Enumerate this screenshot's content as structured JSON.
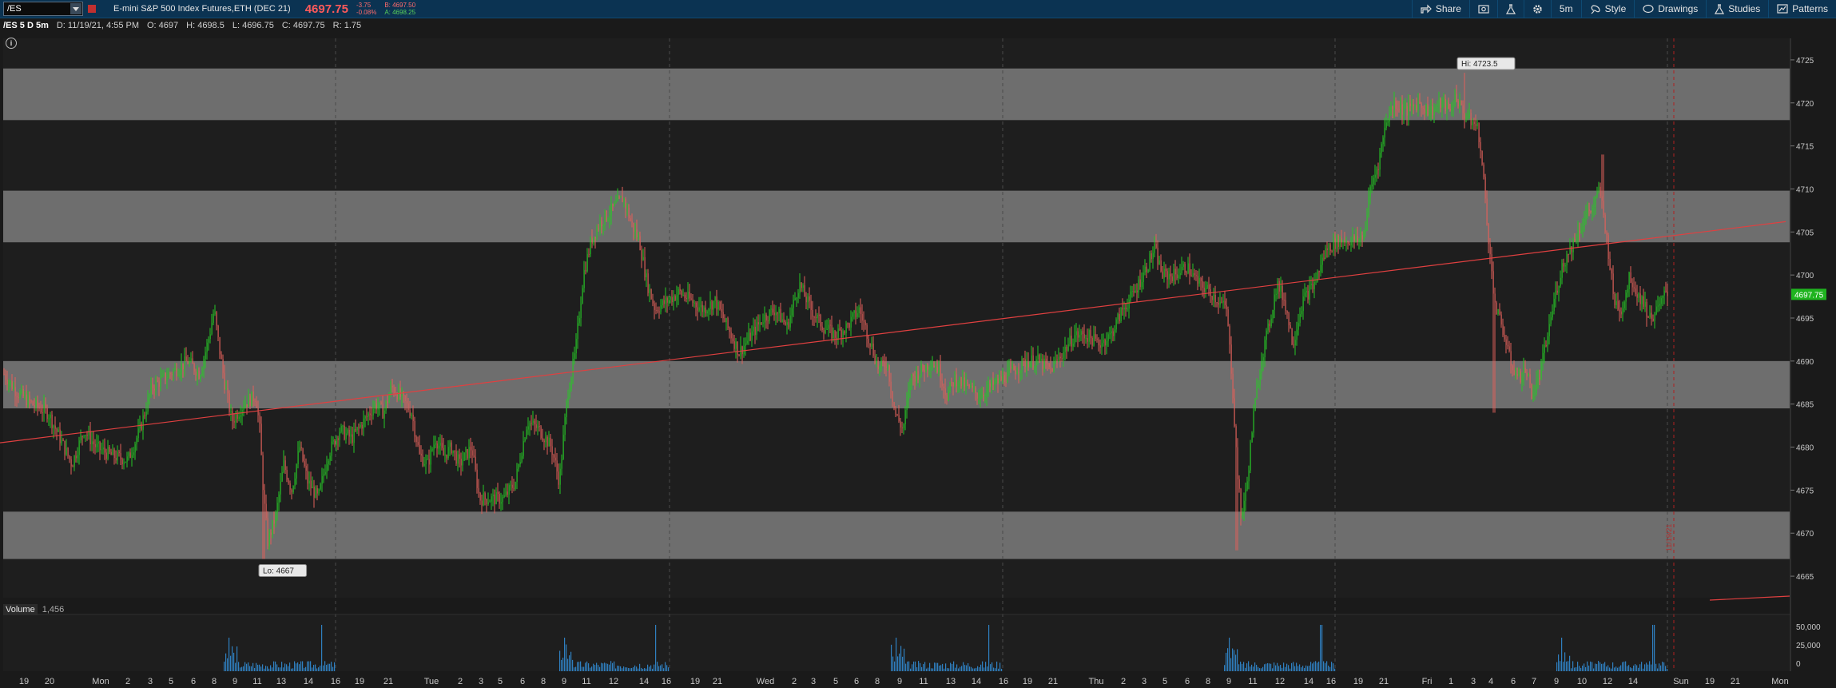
{
  "toolbar": {
    "symbol": "/ES",
    "description": "E-mini S&P 500 Index Futures,ETH (DEC 21)",
    "last_price": "4697.75",
    "net_change": "-3.75",
    "pct_change": "-0.08%",
    "bid": "B: 4697.50",
    "ask": "A: 4698.25",
    "share_label": "Share",
    "timeframe_label": "5m",
    "style_label": "Style",
    "drawings_label": "Drawings",
    "studies_label": "Studies",
    "patterns_label": "Patterns",
    "icons": [
      "share-icon",
      "screenshot-icon",
      "flask-icon",
      "gear-icon",
      "style-icon",
      "drawings-icon",
      "studies-icon",
      "patterns-icon"
    ]
  },
  "infobar": {
    "chart_title": "/ES 5 D 5m",
    "date": "D: 11/19/21, 4:55 PM",
    "open": "O: 4697",
    "high": "H: 4698.5",
    "low": "L: 4696.75",
    "close": "C: 4697.75",
    "range": "R: 1.75"
  },
  "volume": {
    "label": "Volume",
    "value": "1,456"
  },
  "colors": {
    "up": "#26c826",
    "down": "#e0605a",
    "trendline": "#e04040",
    "zone": "#6e6e6e",
    "price_bg": "#1e1e1e",
    "volume": "#2f7fc0",
    "last_price_tag": "#1fb41f"
  },
  "chart_data": {
    "type": "candlestick",
    "instrument": "/ES",
    "interval": "5m",
    "ylim": [
      4662.5,
      4727.5
    ],
    "y_ticks": [
      4665,
      4670,
      4675,
      4680,
      4685,
      4690,
      4695,
      4700,
      4705,
      4710,
      4715,
      4720,
      4725
    ],
    "zones": [
      [
        4667,
        4672.5
      ],
      [
        4684.5,
        4690
      ],
      [
        4703.8,
        4709.8
      ],
      [
        4718,
        4724
      ]
    ],
    "trendline": {
      "from": [
        0,
        4680.5
      ],
      "to": [
        2235,
        4706.2
      ]
    },
    "session_marker": "11/19/21",
    "hi_label": "Hi: 4723.5",
    "lo_label": "Lo: 4667",
    "last_price_tag": "4697.75",
    "path_keypoints": [
      [
        5,
        4688.5
      ],
      [
        20,
        4686.5
      ],
      [
        40,
        4685
      ],
      [
        60,
        4684
      ],
      [
        75,
        4681
      ],
      [
        90,
        4678
      ],
      [
        105,
        4682
      ],
      [
        120,
        4680
      ],
      [
        140,
        4679
      ],
      [
        160,
        4678.5
      ],
      [
        175,
        4682
      ],
      [
        190,
        4687
      ],
      [
        205,
        4688
      ],
      [
        220,
        4689
      ],
      [
        235,
        4690
      ],
      [
        250,
        4688.5
      ],
      [
        262,
        4693
      ],
      [
        268,
        4696
      ],
      [
        272,
        4693
      ],
      [
        280,
        4688
      ],
      [
        290,
        4683
      ],
      [
        305,
        4685
      ],
      [
        320,
        4686
      ],
      [
        325,
        4682
      ],
      [
        330,
        4674
      ],
      [
        335,
        4669
      ],
      [
        345,
        4672
      ],
      [
        355,
        4678
      ],
      [
        365,
        4675
      ],
      [
        375,
        4680
      ],
      [
        385,
        4676
      ],
      [
        398,
        4674
      ],
      [
        410,
        4679
      ],
      [
        425,
        4682
      ],
      [
        440,
        4681
      ],
      [
        455,
        4683
      ],
      [
        470,
        4685
      ],
      [
        480,
        4684
      ],
      [
        490,
        4687
      ],
      [
        500,
        4686
      ],
      [
        515,
        4684
      ],
      [
        525,
        4679
      ],
      [
        535,
        4678
      ],
      [
        545,
        4681
      ],
      [
        555,
        4679
      ],
      [
        565,
        4680
      ],
      [
        575,
        4678
      ],
      [
        590,
        4680
      ],
      [
        600,
        4674
      ],
      [
        615,
        4674
      ],
      [
        630,
        4674
      ],
      [
        645,
        4676
      ],
      [
        660,
        4683
      ],
      [
        675,
        4682
      ],
      [
        690,
        4680
      ],
      [
        700,
        4676
      ],
      [
        710,
        4686
      ],
      [
        720,
        4691
      ],
      [
        730,
        4700
      ],
      [
        740,
        4704
      ],
      [
        750,
        4706
      ],
      [
        760,
        4707
      ],
      [
        770,
        4708
      ],
      [
        780,
        4709
      ],
      [
        790,
        4706
      ],
      [
        800,
        4704
      ],
      [
        810,
        4699
      ],
      [
        820,
        4696
      ],
      [
        835,
        4697
      ],
      [
        850,
        4698
      ],
      [
        865,
        4697
      ],
      [
        880,
        4696
      ],
      [
        895,
        4697
      ],
      [
        910,
        4694
      ],
      [
        925,
        4691
      ],
      [
        940,
        4693
      ],
      [
        955,
        4695
      ],
      [
        970,
        4696
      ],
      [
        985,
        4694
      ],
      [
        1000,
        4699
      ],
      [
        1015,
        4696
      ],
      [
        1030,
        4694
      ],
      [
        1045,
        4693
      ],
      [
        1060,
        4694
      ],
      [
        1075,
        4696
      ],
      [
        1090,
        4692
      ],
      [
        1100,
        4689
      ],
      [
        1110,
        4690
      ],
      [
        1120,
        4684
      ],
      [
        1130,
        4682
      ],
      [
        1140,
        4688
      ],
      [
        1155,
        4689
      ],
      [
        1165,
        4690
      ],
      [
        1175,
        4689
      ],
      [
        1185,
        4686
      ],
      [
        1195,
        4688
      ],
      [
        1210,
        4687
      ],
      [
        1225,
        4686
      ],
      [
        1240,
        4687
      ],
      [
        1255,
        4688
      ],
      [
        1270,
        4689
      ],
      [
        1285,
        4690
      ],
      [
        1300,
        4690
      ],
      [
        1315,
        4689
      ],
      [
        1330,
        4691
      ],
      [
        1345,
        4693
      ],
      [
        1360,
        4693
      ],
      [
        1375,
        4692
      ],
      [
        1390,
        4693
      ],
      [
        1405,
        4696
      ],
      [
        1420,
        4698
      ],
      [
        1435,
        4701
      ],
      [
        1445,
        4703
      ],
      [
        1455,
        4700
      ],
      [
        1470,
        4700
      ],
      [
        1485,
        4701
      ],
      [
        1500,
        4699
      ],
      [
        1515,
        4698
      ],
      [
        1525,
        4697
      ],
      [
        1535,
        4696
      ],
      [
        1542,
        4688
      ],
      [
        1548,
        4678
      ],
      [
        1553,
        4672
      ],
      [
        1560,
        4675
      ],
      [
        1568,
        4683
      ],
      [
        1578,
        4690
      ],
      [
        1588,
        4694
      ],
      [
        1598,
        4699
      ],
      [
        1608,
        4697
      ],
      [
        1618,
        4692
      ],
      [
        1630,
        4697
      ],
      [
        1645,
        4699
      ],
      [
        1660,
        4703
      ],
      [
        1675,
        4704
      ],
      [
        1690,
        4704
      ],
      [
        1700,
        4704
      ],
      [
        1708,
        4705
      ],
      [
        1715,
        4710
      ],
      [
        1725,
        4713
      ],
      [
        1735,
        4718
      ],
      [
        1745,
        4720
      ],
      [
        1760,
        4719
      ],
      [
        1775,
        4720
      ],
      [
        1790,
        4719
      ],
      [
        1805,
        4720
      ],
      [
        1815,
        4719
      ],
      [
        1822,
        4721
      ],
      [
        1830,
        4719
      ],
      [
        1840,
        4718
      ],
      [
        1850,
        4717
      ],
      [
        1858,
        4710
      ],
      [
        1865,
        4702
      ],
      [
        1872,
        4696
      ],
      [
        1880,
        4694
      ],
      [
        1890,
        4690
      ],
      [
        1900,
        4688
      ],
      [
        1910,
        4689
      ],
      [
        1918,
        4686
      ],
      [
        1926,
        4688
      ],
      [
        1935,
        4692
      ],
      [
        1945,
        4697
      ],
      [
        1955,
        4701
      ],
      [
        1965,
        4703
      ],
      [
        1975,
        4705
      ],
      [
        1985,
        4707
      ],
      [
        1995,
        4708
      ],
      [
        2002,
        4710
      ],
      [
        2010,
        4705
      ],
      [
        2020,
        4697
      ],
      [
        2030,
        4696
      ],
      [
        2040,
        4700
      ],
      [
        2048,
        4698
      ],
      [
        2056,
        4697
      ],
      [
        2065,
        4695
      ],
      [
        2075,
        4696
      ],
      [
        2085,
        4698
      ]
    ],
    "x_tick_labels": [
      [
        "19",
        30
      ],
      [
        "20",
        62
      ],
      [
        "Mon",
        126
      ],
      [
        "2",
        160
      ],
      [
        "3",
        188
      ],
      [
        "5",
        214
      ],
      [
        "6",
        242
      ],
      [
        "8",
        268
      ],
      [
        "9",
        294
      ],
      [
        "11",
        322
      ],
      [
        "13",
        352
      ],
      [
        "14",
        386
      ],
      [
        "16",
        420
      ],
      [
        "19",
        450
      ],
      [
        "21",
        486
      ],
      [
        "Tue",
        540
      ],
      [
        "2",
        576
      ],
      [
        "3",
        602
      ],
      [
        "5",
        626
      ],
      [
        "6",
        654
      ],
      [
        "8",
        680
      ],
      [
        "9",
        706
      ],
      [
        "11",
        734
      ],
      [
        "12",
        768
      ],
      [
        "14",
        806
      ],
      [
        "16",
        834
      ],
      [
        "19",
        870
      ],
      [
        "21",
        898
      ],
      [
        "Wed",
        958
      ],
      [
        "2",
        994
      ],
      [
        "3",
        1018
      ],
      [
        "5",
        1046
      ],
      [
        "6",
        1072
      ],
      [
        "8",
        1098
      ],
      [
        "9",
        1126
      ],
      [
        "11",
        1156
      ],
      [
        "13",
        1190
      ],
      [
        "14",
        1222
      ],
      [
        "16",
        1256
      ],
      [
        "19",
        1286
      ],
      [
        "21",
        1318
      ],
      [
        "Thu",
        1372
      ],
      [
        "2",
        1406
      ],
      [
        "3",
        1432
      ],
      [
        "5",
        1458
      ],
      [
        "6",
        1486
      ],
      [
        "8",
        1512
      ],
      [
        "9",
        1538
      ],
      [
        "11",
        1568
      ],
      [
        "12",
        1602
      ],
      [
        "14",
        1638
      ],
      [
        "16",
        1666
      ],
      [
        "19",
        1700
      ],
      [
        "21",
        1732
      ],
      [
        "Fri",
        1786
      ],
      [
        "1",
        1816
      ],
      [
        "3",
        1844
      ],
      [
        "4",
        1866
      ],
      [
        "6",
        1894
      ],
      [
        "7",
        1920
      ],
      [
        "9",
        1948
      ],
      [
        "10",
        1980
      ],
      [
        "12",
        2012
      ],
      [
        "14",
        2044
      ],
      [
        "Sun",
        2104
      ],
      [
        "19",
        2140
      ],
      [
        "21",
        2172
      ],
      [
        "Mon",
        2228
      ]
    ],
    "volume_axis": [
      "50,000",
      "25,000",
      "0"
    ]
  }
}
